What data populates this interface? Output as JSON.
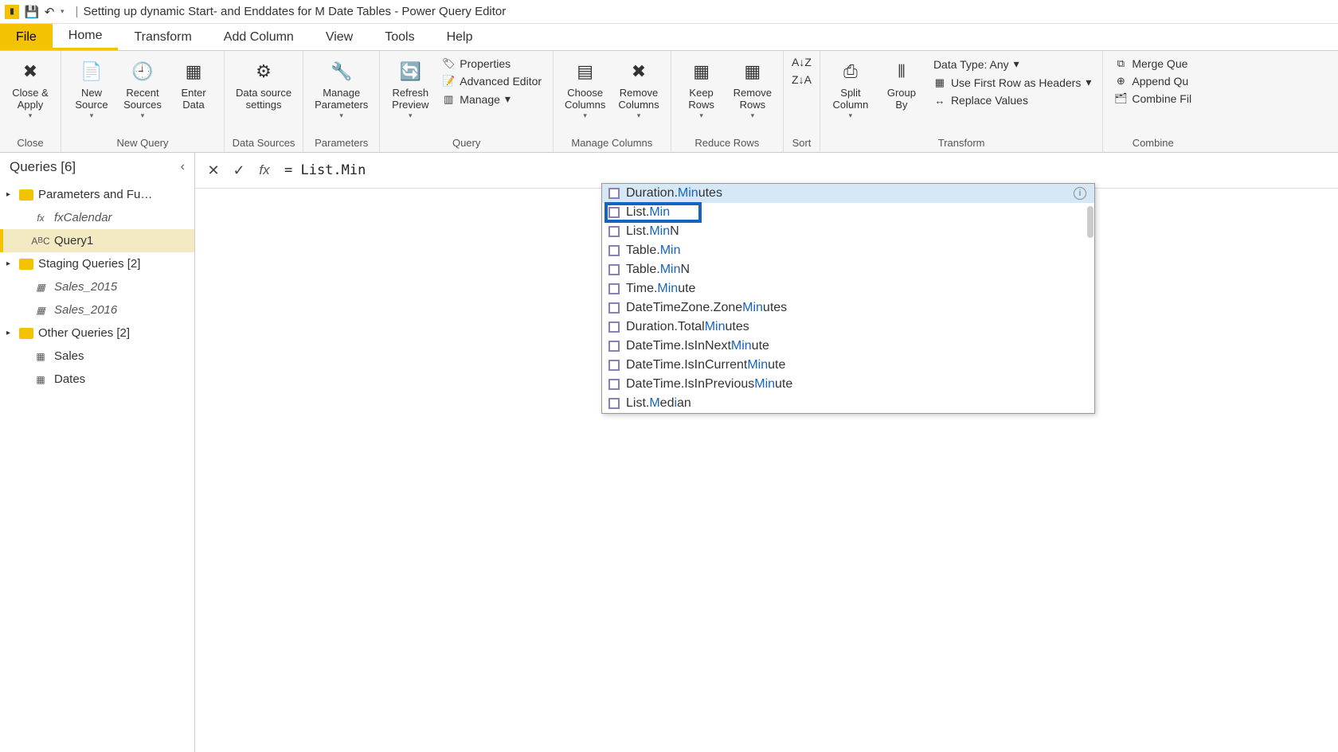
{
  "title": "Setting up dynamic Start- and Enddates for M Date Tables - Power Query Editor",
  "menubar": {
    "file": "File",
    "tabs": [
      "Home",
      "Transform",
      "Add Column",
      "View",
      "Tools",
      "Help"
    ]
  },
  "ribbon": {
    "close": {
      "close_apply": "Close &\nApply",
      "group": "Close"
    },
    "newquery": {
      "new_source": "New\nSource",
      "recent_sources": "Recent\nSources",
      "enter_data": "Enter\nData",
      "group": "New Query"
    },
    "datasources": {
      "settings": "Data source\nsettings",
      "group": "Data Sources"
    },
    "parameters": {
      "manage": "Manage\nParameters",
      "group": "Parameters"
    },
    "query": {
      "refresh": "Refresh\nPreview",
      "properties": "Properties",
      "adv": "Advanced Editor",
      "managebtn": "Manage",
      "group": "Query"
    },
    "managecols": {
      "choose": "Choose\nColumns",
      "remove": "Remove\nColumns",
      "group": "Manage Columns"
    },
    "reducerows": {
      "keep": "Keep\nRows",
      "remove": "Remove\nRows",
      "group": "Reduce Rows"
    },
    "sort": {
      "group": "Sort"
    },
    "transform": {
      "split": "Split\nColumn",
      "groupby": "Group\nBy",
      "datatype": "Data Type: Any",
      "firstrow": "Use First Row as Headers",
      "replace": "Replace Values",
      "group": "Transform"
    },
    "combine": {
      "merge": "Merge Que",
      "append": "Append Qu",
      "combinef": "Combine Fil",
      "group": "Combine"
    }
  },
  "queries": {
    "header": "Queries [6]",
    "folders": [
      {
        "name": "Parameters and Fu…",
        "items": [
          {
            "name": "fxCalendar",
            "icon": "fx",
            "italic": true
          },
          {
            "name": "Query1",
            "icon": "abc",
            "selected": true
          }
        ]
      },
      {
        "name": "Staging Queries [2]",
        "items": [
          {
            "name": "Sales_2015",
            "icon": "tbl",
            "italic": true
          },
          {
            "name": "Sales_2016",
            "icon": "tbl",
            "italic": true
          }
        ]
      },
      {
        "name": "Other Queries [2]",
        "items": [
          {
            "name": "Sales",
            "icon": "tbl"
          },
          {
            "name": "Dates",
            "icon": "tbl"
          }
        ]
      }
    ]
  },
  "formula": "= List.Min",
  "autocomplete": [
    {
      "pre": "Duration.",
      "hl": "Min",
      "post": "utes",
      "hover": true
    },
    {
      "pre": "List.",
      "hl": "Min",
      "post": "",
      "selected": true
    },
    {
      "pre": "List.",
      "hl": "Min",
      "post": "N"
    },
    {
      "pre": "Table.",
      "hl": "Min",
      "post": ""
    },
    {
      "pre": "Table.",
      "hl": "Min",
      "post": "N"
    },
    {
      "pre": "Time.",
      "hl": "Min",
      "post": "ute"
    },
    {
      "pre": "DateTimeZone.Zone",
      "hl": "Min",
      "post": "utes"
    },
    {
      "pre": "Duration.Total",
      "hl": "Min",
      "post": "utes"
    },
    {
      "pre": "DateTime.IsInNext",
      "hl": "Min",
      "post": "ute"
    },
    {
      "pre": "DateTime.IsInCurrent",
      "hl": "Min",
      "post": "ute"
    },
    {
      "pre": "DateTime.IsInPrevious",
      "hl": "Min",
      "post": "ute"
    },
    {
      "pre": "List.",
      "hl": "M",
      "post": "edian",
      "hl2": "i"
    }
  ]
}
